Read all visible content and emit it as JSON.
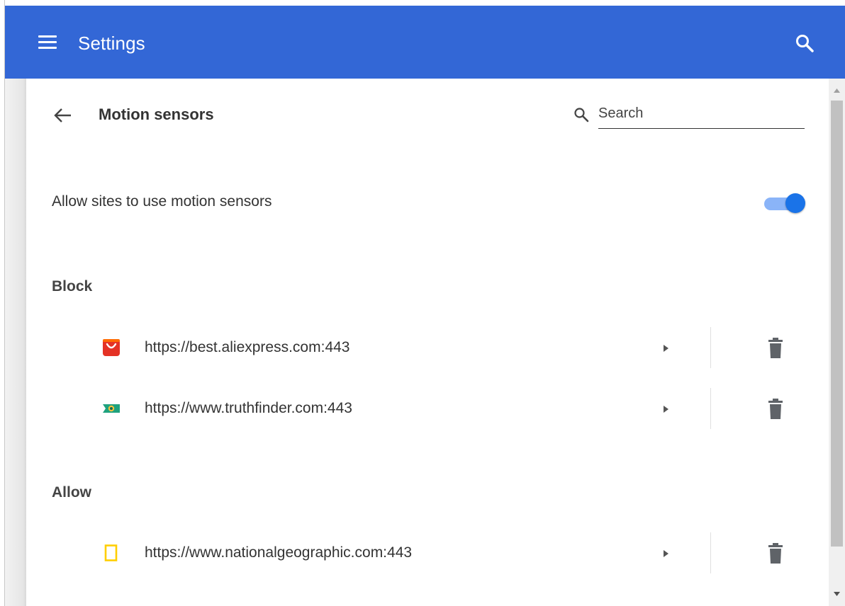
{
  "header": {
    "title": "Settings",
    "bg_color": "#3367d6",
    "menu_icon": "hamburger-menu-icon",
    "search_icon": "search-icon"
  },
  "page": {
    "title": "Motion sensors",
    "back_icon": "arrow-left-icon",
    "search": {
      "placeholder": "Search",
      "value": ""
    }
  },
  "setting": {
    "label": "Allow sites to use motion sensors",
    "enabled": true,
    "accent": "#1a73e8"
  },
  "sections": [
    {
      "heading": "Block",
      "sites": [
        {
          "url": "https://best.aliexpress.com:443",
          "favicon": "aliexpress-favicon"
        },
        {
          "url": "https://www.truthfinder.com:443",
          "favicon": "truthfinder-favicon"
        }
      ]
    },
    {
      "heading": "Allow",
      "sites": [
        {
          "url": "https://www.nationalgeographic.com:443",
          "favicon": "nationalgeographic-favicon"
        }
      ]
    }
  ],
  "row_icons": {
    "expand": "chevron-right-icon",
    "delete": "trash-icon"
  }
}
